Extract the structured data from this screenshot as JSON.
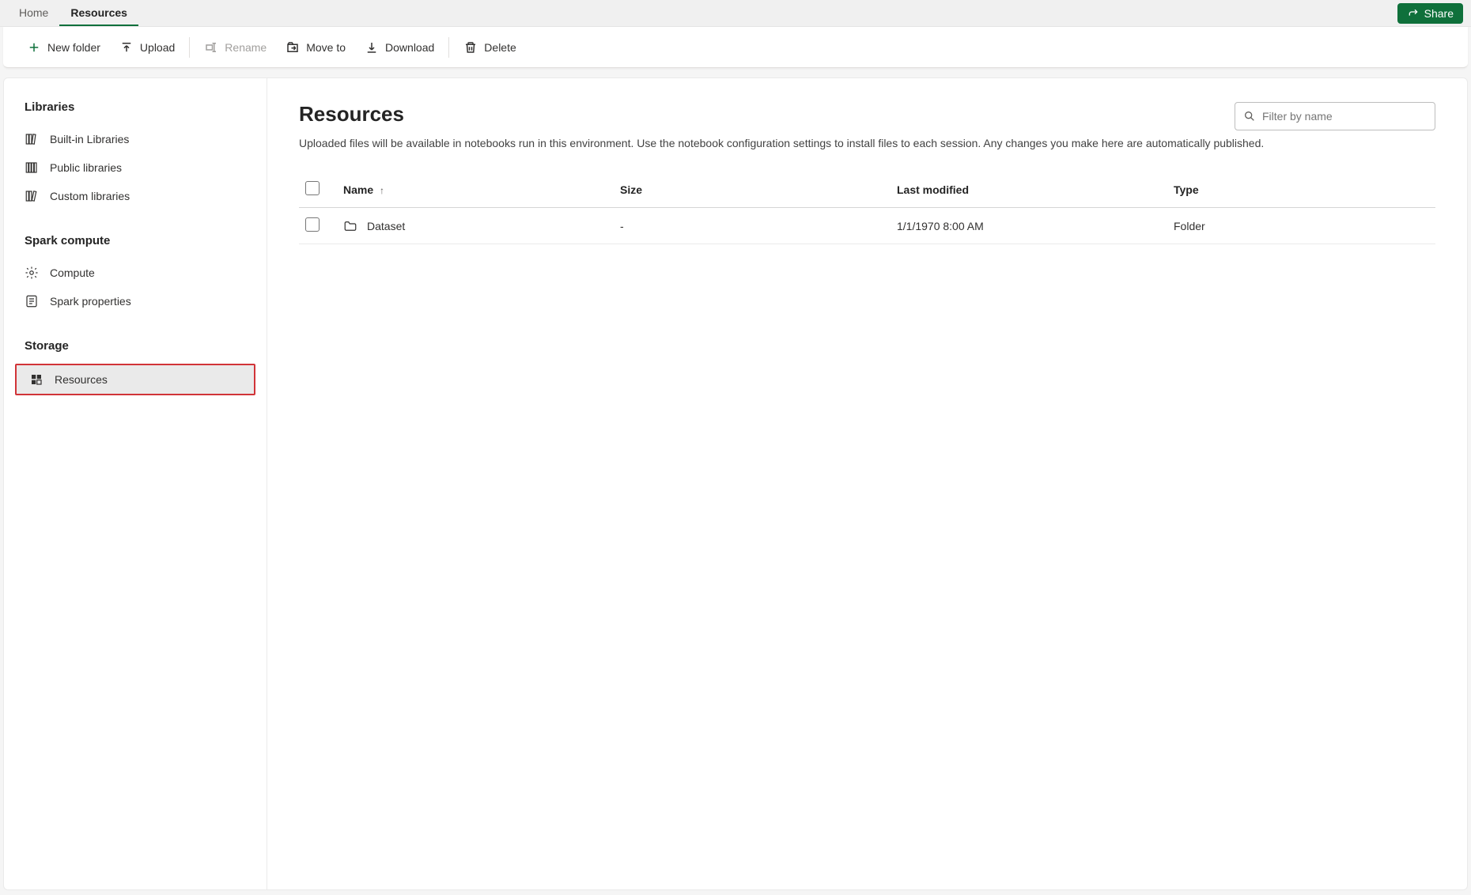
{
  "header": {
    "tabs": [
      "Home",
      "Resources"
    ],
    "active_tab": 1,
    "share_label": "Share"
  },
  "toolbar": {
    "new_folder": "New folder",
    "upload": "Upload",
    "rename": "Rename",
    "move_to": "Move to",
    "download": "Download",
    "delete": "Delete"
  },
  "sidebar": {
    "sections": [
      {
        "label": "Libraries",
        "items": [
          {
            "label": "Built-in Libraries",
            "icon": "books"
          },
          {
            "label": "Public libraries",
            "icon": "books3"
          },
          {
            "label": "Custom libraries",
            "icon": "books2"
          }
        ]
      },
      {
        "label": "Spark compute",
        "items": [
          {
            "label": "Compute",
            "icon": "gear"
          },
          {
            "label": "Spark properties",
            "icon": "doc-list"
          }
        ]
      },
      {
        "label": "Storage",
        "items": [
          {
            "label": "Resources",
            "icon": "resources",
            "active": true
          }
        ]
      }
    ]
  },
  "main": {
    "title": "Resources",
    "description": "Uploaded files will be available in notebooks run in this environment. Use the notebook configuration settings to install files to each session. Any changes you make here are automatically published.",
    "filter_placeholder": "Filter by name",
    "columns": {
      "name": "Name",
      "size": "Size",
      "modified": "Last modified",
      "type": "Type"
    },
    "rows": [
      {
        "name": "Dataset",
        "size": "-",
        "modified": "1/1/1970 8:00 AM",
        "type": "Folder"
      }
    ]
  }
}
